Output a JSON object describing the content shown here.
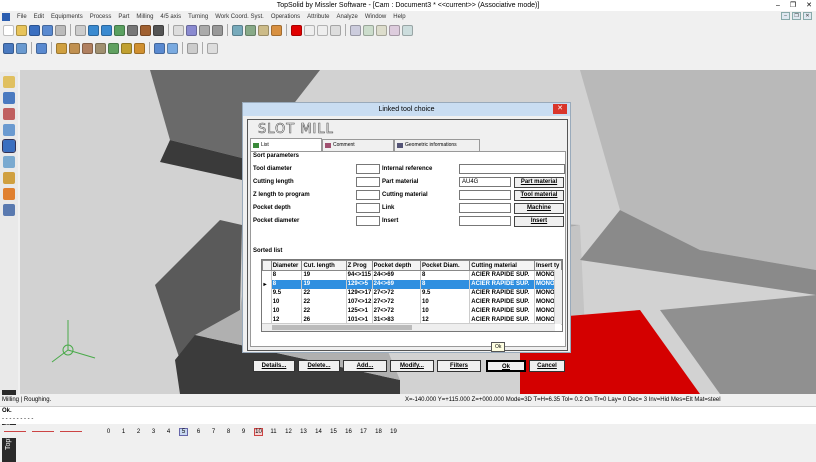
{
  "app": {
    "title": "TopSolid by Missler Software - [Cam : Document3 *  <<current>> (Associative mode)]",
    "min": "–",
    "max": "❐",
    "close": "✕",
    "side_label": "TopSolid · Cam"
  },
  "menu": [
    "File",
    "Edit",
    "Equipments",
    "Process",
    "Part",
    "Milling",
    "4/5 axis",
    "Turning",
    "Work Coord. Syst.",
    "Operations",
    "Attribute",
    "Analyze",
    "Window",
    "Help"
  ],
  "dialog": {
    "title": "Linked tool choice",
    "close": "✕",
    "tool_name": "SLOT MILL",
    "tabs": [
      "List",
      "Comment",
      "Geometric informations"
    ],
    "sort_params": "Sort parameters",
    "left_fields": [
      "Tool diameter",
      "Cutting length",
      "Z length to program",
      "Pocket depth",
      "Pocket diameter"
    ],
    "right_fields": [
      "Internal reference",
      "Part material",
      "Cutting material",
      "Link",
      "Insert"
    ],
    "part_material_value": "AU4G",
    "side_buttons": [
      "Part material",
      "Tool material",
      "Machine",
      "Insert"
    ],
    "sorted_list": "Sorted list",
    "columns": [
      "Diameter",
      "Cut. length",
      "Z Prog",
      "Pocket depth",
      "Pocket Diam.",
      "Cutting material",
      "Insert ty"
    ],
    "rows": [
      {
        "marker": "",
        "cells": [
          "8",
          "19",
          "94<>115",
          "24<>69",
          "8",
          "ACIER RAPIDE SUP.",
          "MONOBI"
        ]
      },
      {
        "marker": "▸",
        "cells": [
          "8",
          "19",
          "129<>5",
          "24<>69",
          "8",
          "ACIER RAPIDE SUP.",
          "MONOBI"
        ]
      },
      {
        "marker": "",
        "cells": [
          "9.5",
          "22",
          "129<>17",
          "27<>72",
          "9.5",
          "ACIER RAPIDE SUP.",
          "MONOBI"
        ]
      },
      {
        "marker": "",
        "cells": [
          "10",
          "22",
          "107<>12",
          "27<>72",
          "10",
          "ACIER RAPIDE SUP.",
          "MONOBI"
        ]
      },
      {
        "marker": "",
        "cells": [
          "10",
          "22",
          "125<>1",
          "27<>72",
          "10",
          "ACIER RAPIDE SUP.",
          "MONOBI"
        ]
      },
      {
        "marker": "",
        "cells": [
          "12",
          "26",
          "101<>1",
          "31<>83",
          "12",
          "ACIER RAPIDE SUP.",
          "MONOBI"
        ]
      }
    ],
    "bottom_buttons": [
      "Details...",
      "Delete...",
      "Add...",
      "Modify...",
      "Filters",
      "Ok",
      "Cancel"
    ],
    "tooltip": "Ok"
  },
  "status": {
    "left": "Milling | Roughing.",
    "coords": "X=-140.000  Y=+115.000  Z=+000.000  Mode=3D  T=H=6.35  Tol= 0.2  On  Tr=0  Lay= 0  Dec= 3  Inv=Hid  Mes=Elt  Mat=steel"
  },
  "command": {
    "line1": "Ok.",
    "line2": "- - - - - - - - -"
  },
  "pages": [
    "0",
    "1",
    "2",
    "3",
    "4",
    "5",
    "6",
    "7",
    "8",
    "9",
    "10",
    "11",
    "12",
    "13",
    "14",
    "15",
    "16",
    "17",
    "18",
    "19"
  ],
  "colors": {
    "selection": "#2f8fe0",
    "red_part": "#d40000",
    "dialog_title": "#c9ddf2"
  }
}
